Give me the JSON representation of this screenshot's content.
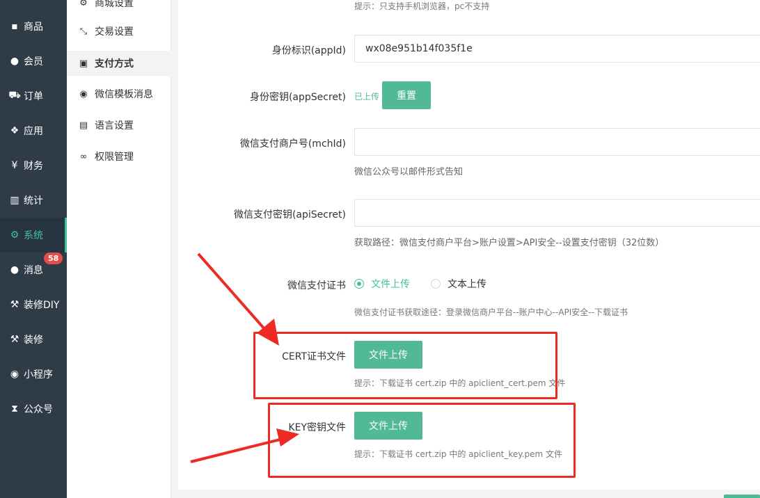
{
  "sidebar": {
    "items": [
      {
        "label": "商品",
        "icon": "archive-icon",
        "glyph": "▪"
      },
      {
        "label": "会员",
        "icon": "users-icon",
        "glyph": "●"
      },
      {
        "label": "订单",
        "icon": "cart-icon",
        "glyph": "⛟"
      },
      {
        "label": "应用",
        "icon": "cubes-icon",
        "glyph": "❖"
      },
      {
        "label": "财务",
        "icon": "yen-icon",
        "glyph": "¥"
      },
      {
        "label": "统计",
        "icon": "bar-chart-icon",
        "glyph": "▥"
      },
      {
        "label": "系统",
        "icon": "gears-icon",
        "glyph": "⚙"
      },
      {
        "label": "消息",
        "icon": "comment-icon",
        "glyph": "●",
        "badge": "58"
      },
      {
        "label": "装修DIY",
        "icon": "gavel-icon",
        "glyph": "⚒"
      },
      {
        "label": "装修",
        "icon": "gavel-icon",
        "glyph": "⚒"
      },
      {
        "label": "小程序",
        "icon": "wechat-icon",
        "glyph": "◉"
      },
      {
        "label": "公众号",
        "icon": "hourglass-icon",
        "glyph": "⧗"
      }
    ],
    "active_index": 6
  },
  "subnav": {
    "items": [
      {
        "label": "商城设置",
        "icon": "gear-icon",
        "glyph": "⚙"
      },
      {
        "label": "交易设置",
        "icon": "compress-icon",
        "glyph": "⤡"
      },
      {
        "label": "支付方式",
        "icon": "facebook-square-icon",
        "glyph": "▣"
      },
      {
        "label": "微信模板消息",
        "icon": "wechat-icon",
        "glyph": "◉"
      },
      {
        "label": "语言设置",
        "icon": "language-icon",
        "glyph": "▤"
      },
      {
        "label": "权限管理",
        "icon": "link-icon",
        "glyph": "∞"
      }
    ],
    "active_index": 2
  },
  "form": {
    "top_hint": "提示：只支持手机浏览器，pc不支持",
    "appid_label": "身份标识(appId)",
    "appid_value": "wx08e951b14f035f1e",
    "appsecret_label": "身份密钥(appSecret)",
    "appsecret_status": "已上传",
    "appsecret_reset": "重置",
    "mchid_label": "微信支付商户号(mchId)",
    "mchid_value": "",
    "mchid_hint": "微信公众号以邮件形式告知",
    "apisecret_label": "微信支付密钥(apiSecret)",
    "apisecret_value": "",
    "apisecret_hint": "获取路径：微信支付商户平台>账户设置>API安全--设置支付密钥（32位数）",
    "cert_label": "微信支付证书",
    "cert_option_file": "文件上传",
    "cert_option_text": "文本上传",
    "cert_hint": "微信支付证书获取途径：登录微信商户平台--账户中心--API安全--下载证书",
    "cert_file_label": "CERT证书文件",
    "cert_file_button": "文件上传",
    "cert_file_hint": "提示：下载证书 cert.zip 中的 apiclient_cert.pem 文件",
    "key_file_label": "KEY密钥文件",
    "key_file_button": "文件上传",
    "key_file_hint": "提示：下载证书 cert.zip 中的 apiclient_key.pem 文件"
  },
  "colors": {
    "sidebar_bg": "#2f3b47",
    "accent": "#42c29b",
    "button": "#52b997",
    "badge": "#e64c4c",
    "annotation_red": "#ee2a24"
  }
}
